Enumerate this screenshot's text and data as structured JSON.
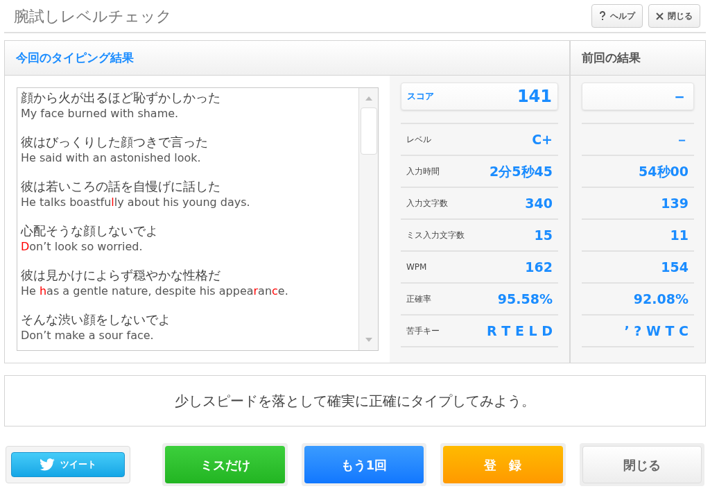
{
  "window": {
    "title": "腕試しレベルチェック"
  },
  "header_buttons": [
    {
      "kind": "help",
      "label": "ヘルプ"
    },
    {
      "kind": "close",
      "label": "閉じる"
    }
  ],
  "current": {
    "heading": "今回のタイピング結果",
    "sentences": [
      {
        "japanese": "顔から火が出るほど恥ずかしかった",
        "english": [
          {
            "text": "My face burned with shame.",
            "miss": false
          }
        ]
      },
      {
        "japanese": "彼はびっくりした顔つきで言った",
        "english": [
          {
            "text": "He said with an astonished look.",
            "miss": false
          }
        ]
      },
      {
        "japanese": "彼は若いころの話を自慢げに話した",
        "english": [
          {
            "text": "He talks boastfu",
            "miss": false
          },
          {
            "text": "l",
            "miss": true
          },
          {
            "text": "ly about his young days.",
            "miss": false
          }
        ]
      },
      {
        "japanese": "心配そうな顔しないでよ",
        "english": [
          {
            "text": "D",
            "miss": true
          },
          {
            "text": "on’t look so worried.",
            "miss": false
          }
        ]
      },
      {
        "japanese": "彼は見かけによらず穏やかな性格だ",
        "english": [
          {
            "text": "He ",
            "miss": false
          },
          {
            "text": "h",
            "miss": true
          },
          {
            "text": "as a gentle nature, despite his appea",
            "miss": false
          },
          {
            "text": "r",
            "miss": true
          },
          {
            "text": "an",
            "miss": false
          },
          {
            "text": "c",
            "miss": true
          },
          {
            "text": "e.",
            "miss": false
          }
        ]
      },
      {
        "japanese": "そんな渋い顔をしないでよ",
        "english": [
          {
            "text": "Don’t make a sour face.",
            "miss": false
          }
        ]
      }
    ],
    "stats": [
      {
        "label": "スコア",
        "value": "141",
        "kind": "score"
      },
      {
        "label": "レベル",
        "value": "C+",
        "kind": "row"
      },
      {
        "label": "入力時間",
        "value": "2分5秒45",
        "kind": "row"
      },
      {
        "label": "入力文字数",
        "value": "340",
        "kind": "row"
      },
      {
        "label": "ミス入力文字数",
        "value": "15",
        "kind": "row"
      },
      {
        "label": "WPM",
        "value": "162",
        "kind": "row"
      },
      {
        "label": "正確率",
        "value": "95.58%",
        "kind": "row"
      },
      {
        "label": "苦手キー",
        "value": "R T E L D",
        "kind": "row"
      }
    ]
  },
  "previous": {
    "heading": "前回の結果",
    "stats": [
      {
        "value": "－",
        "kind": "score"
      },
      {
        "value": "－",
        "kind": "row"
      },
      {
        "value": "54秒00",
        "kind": "row"
      },
      {
        "value": "139",
        "kind": "row"
      },
      {
        "value": "11",
        "kind": "row"
      },
      {
        "value": "154",
        "kind": "row"
      },
      {
        "value": "92.08%",
        "kind": "row"
      },
      {
        "value": "’ ? W T C",
        "kind": "row"
      }
    ]
  },
  "message": "少しスピードを落として確実に正確にタイプしてみよう。",
  "buttons": [
    {
      "kind": "tweet",
      "label": "ツイート"
    },
    {
      "kind": "green",
      "label": "ミスだけ"
    },
    {
      "kind": "blue",
      "label": "もう1回"
    },
    {
      "kind": "orange",
      "label": "登　録"
    },
    {
      "kind": "plain",
      "label": "閉じる"
    }
  ]
}
